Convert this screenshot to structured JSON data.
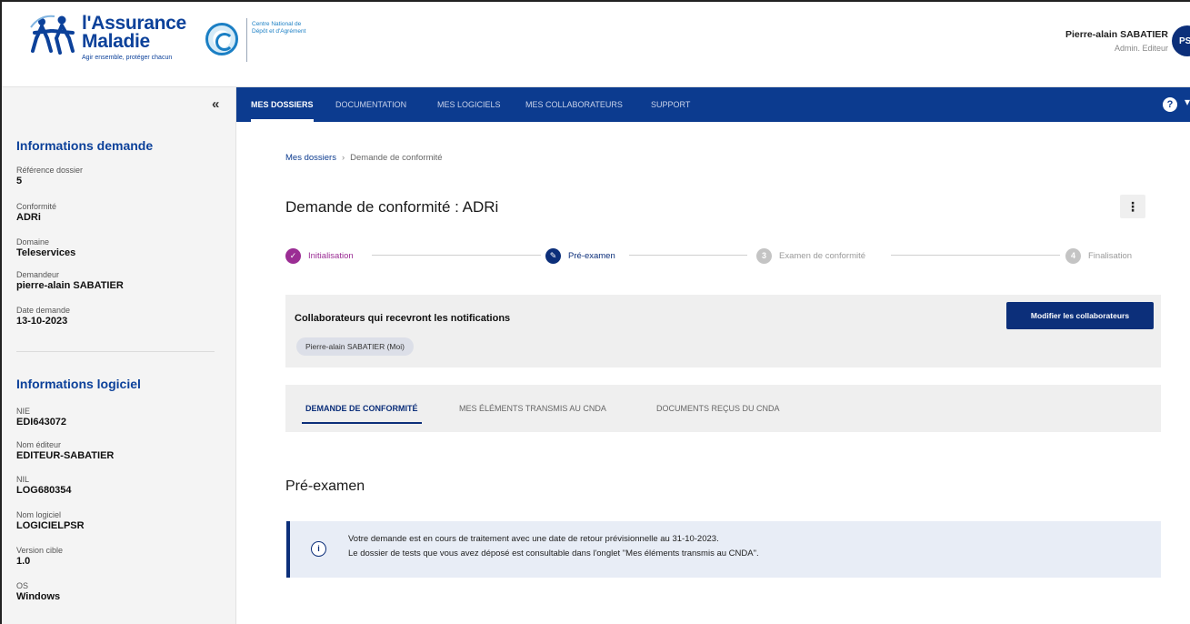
{
  "header": {
    "brand": {
      "line1": "l'Assurance",
      "line2": "Maladie",
      "tagline": "Agir ensemble, protéger chacun"
    },
    "partner": {
      "text": "Centre National de Dépôt et d'Agrément"
    },
    "user": {
      "name": "Pierre-alain SABATIER",
      "role": "Admin. Editeur",
      "initials": "PS"
    }
  },
  "sidebar": {
    "collapse_glyph": "«",
    "request_title": "Informations demande",
    "request_fields": [
      {
        "label": "Référence dossier",
        "value": "5"
      },
      {
        "label": "Conformité",
        "value": "ADRi"
      },
      {
        "label": "Domaine",
        "value": "Teleservices"
      },
      {
        "label": "Demandeur",
        "value": "pierre-alain SABATIER"
      },
      {
        "label": "Date demande",
        "value": "13-10-2023"
      }
    ],
    "software_title": "Informations logiciel",
    "software_fields": [
      {
        "label": "NIE",
        "value": "EDI643072"
      },
      {
        "label": "Nom éditeur",
        "value": "EDITEUR-SABATIER"
      },
      {
        "label": "NIL",
        "value": "LOG680354"
      },
      {
        "label": "Nom logiciel",
        "value": "LOGICIELPSR"
      },
      {
        "label": "Version cible",
        "value": "1.0"
      },
      {
        "label": "OS",
        "value": "Windows"
      }
    ]
  },
  "nav": {
    "tabs": [
      {
        "label": "Mes dossiers",
        "active": true
      },
      {
        "label": "Documentation",
        "active": false
      },
      {
        "label": "Mes logiciels",
        "active": false
      },
      {
        "label": "Mes collaborateurs",
        "active": false
      },
      {
        "label": "Support",
        "active": false
      }
    ],
    "help_glyph": "?",
    "caret_glyph": "▾"
  },
  "breadcrumb": {
    "root": "Mes dossiers",
    "separator": "›",
    "current": "Demande de conformité"
  },
  "page": {
    "title": "Demande de conformité : ADRi",
    "menu_glyph": "⋮"
  },
  "stepper": {
    "steps": [
      {
        "label": "Initialisation",
        "status": "done",
        "marker": "✓"
      },
      {
        "label": "Pré-examen",
        "status": "current",
        "marker": "✎"
      },
      {
        "label": "Examen de conformité",
        "status": "todo",
        "marker": "3"
      },
      {
        "label": "Finalisation",
        "status": "todo",
        "marker": "4"
      }
    ]
  },
  "collaborators": {
    "title": "Collaborateurs qui recevront les notifications",
    "chip": "Pierre-alain SABATIER (Moi)",
    "button": "Modifier les collaborateurs"
  },
  "subtabs": [
    {
      "label": "Demande de conformité",
      "active": true
    },
    {
      "label": "Mes éléments transmis au CNDA",
      "active": false
    },
    {
      "label": "Documents reçus du CNDA",
      "active": false
    }
  ],
  "section": {
    "title": "Pré-examen",
    "info_icon": "i",
    "info_lines": [
      "Votre demande est en cours de traitement avec une date de retour prévisionnelle au 31-10-2023.",
      "Le dossier de tests que vous avez déposé est consultable dans l'onglet \"Mes éléments transmis au CNDA\"."
    ]
  },
  "colors": {
    "nav_bg": "#0c3b8f",
    "primary": "#0c2f7a",
    "brand_blue": "#0c419a",
    "step_done": "#9b2d94",
    "panel_bg": "#efefef",
    "info_bg": "#e8edf6"
  }
}
